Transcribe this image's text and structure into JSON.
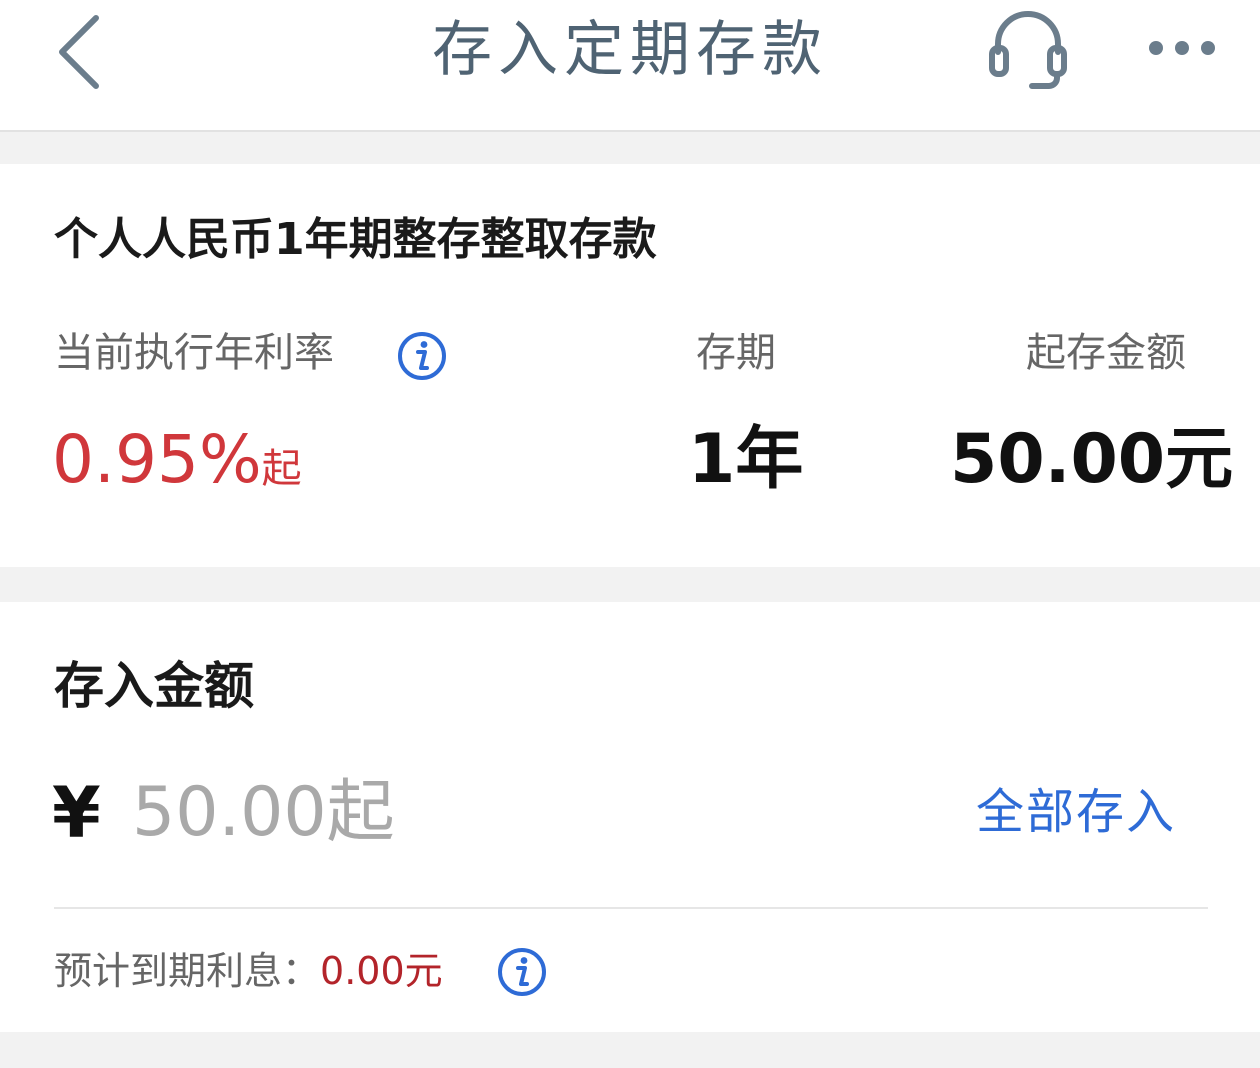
{
  "header": {
    "title": "存入定期存款",
    "back_icon": "chevron-left-icon",
    "service_icon": "headset-icon",
    "more_icon": "more-dots-icon",
    "icon_color": "#6b7d8c"
  },
  "product": {
    "name": "个人人民币1年期整存整取存款",
    "rate_label": "当前执行年利率",
    "rate_value": "0.95%",
    "rate_suffix": "起",
    "term_label": "存期",
    "term_value": "1年",
    "min_label": "起存金额",
    "min_value": "50.00元",
    "rate_color": "#d0373b"
  },
  "deposit": {
    "title": "存入金额",
    "currency_symbol": "¥",
    "amount_value": "",
    "amount_placeholder": "50.00起",
    "all_in_label": "全部存入",
    "interest_label": "预计到期利息：",
    "interest_value": "0.00元",
    "link_color": "#2e6bd6"
  }
}
